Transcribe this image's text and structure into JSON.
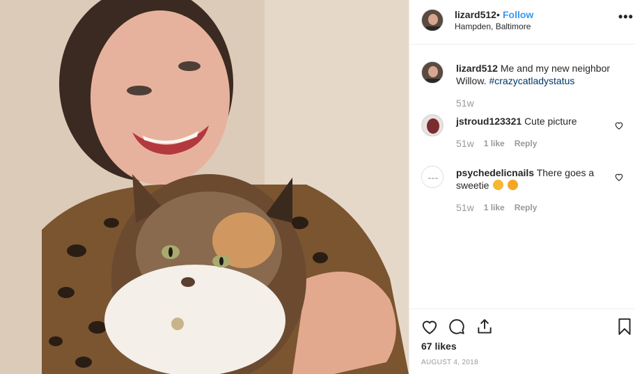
{
  "post": {
    "username": "lizard512",
    "separator": "•",
    "follow_label": "Follow",
    "location": "Hampden, Baltimore",
    "more_label": "•••"
  },
  "caption": {
    "username": "lizard512",
    "text": "Me and my new neighbor Willow.",
    "hashtag": "#crazycatladystatus",
    "time": "51w"
  },
  "comments": [
    {
      "username": "jstroud123321",
      "text": "Cute picture",
      "time": "51w",
      "likes": "1 like",
      "reply": "Reply"
    },
    {
      "username": "psychedelicnails",
      "text": "There goes a sweetie",
      "emojis": [
        "heart-eyes-emoji",
        "kissing-face-emoji"
      ],
      "time": "51w",
      "likes": "1 like",
      "reply": "Reply"
    }
  ],
  "footer": {
    "likes": "67 likes",
    "date": "AUGUST 4, 2018"
  },
  "icons": [
    "more-options-icon",
    "heart-icon",
    "comment-icon",
    "share-icon",
    "bookmark-icon",
    "like-comment-icon"
  ],
  "colors": {
    "link": "#3897f0",
    "hashtag": "#003569",
    "meta": "#999999"
  }
}
